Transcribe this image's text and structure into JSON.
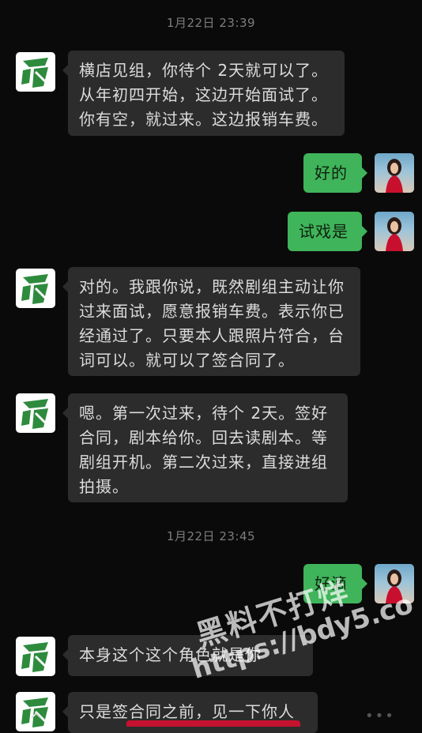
{
  "timestamps": [
    "1月22日 23:39",
    "1月22日 23:45"
  ],
  "messages": [
    {
      "side": "in",
      "text": "横店见组，你待个 2天就可以了。从年初四开始，这边开始面试了。你有空，就过来。这边报销车费。"
    },
    {
      "side": "out",
      "text": "好的"
    },
    {
      "side": "out",
      "text": "试戏是"
    },
    {
      "side": "in",
      "text": "对的。我跟你说，既然剧组主动让你过来面试，愿意报销车费。表示你已经通过了。只要本人跟照片符合，台词可以。就可以了签合同了。"
    },
    {
      "side": "in",
      "text": "嗯。第一次过来，待个 2天。签好合同，剧本给你。回去读剧本。等剧组开机。第二次过来，直接进组拍摄。"
    },
    {
      "side": "out",
      "text": "好滴"
    },
    {
      "side": "in",
      "text": "本身这个这个角色就是你"
    },
    {
      "side": "in",
      "text": "只是签合同之前，见一下你人"
    }
  ],
  "watermark": {
    "line1": "黑料不打烊",
    "line2": "https://bdy5.co"
  },
  "icons": {
    "contact_avatar": "green-logo-avatar",
    "self_avatar": "photo-avatar"
  }
}
